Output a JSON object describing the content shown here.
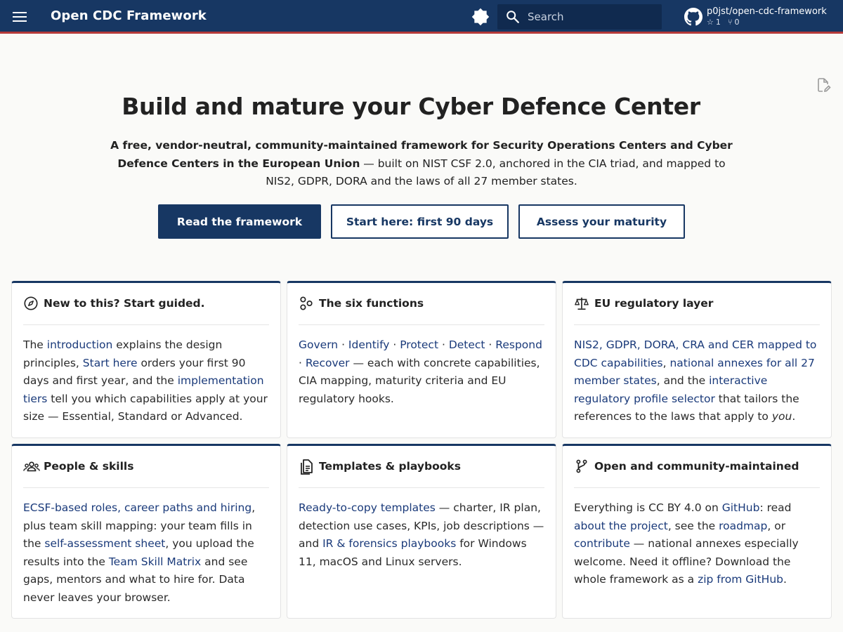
{
  "header": {
    "site_title": "Open CDC Framework",
    "search_placeholder": "Search",
    "repo_name": "p0jst/open-cdc-framework",
    "stars": "1",
    "forks": "0",
    "icons": {
      "menu": "menu-icon",
      "theme": "theme-toggle-icon",
      "search": "search-icon",
      "repo": "github-icon"
    }
  },
  "hero": {
    "title": "Build and mature your Cyber Defence Center",
    "subtitle_bold": "A free, vendor-neutral, community-maintained framework for Security Operations Centers and Cyber Defence Centers in the European Union",
    "subtitle_rest": " — built on NIST CSF 2.0, anchored in the CIA triad, and mapped to NIS2, GDPR, DORA and the laws of all 27 member states.",
    "buttons": {
      "read": "Read the framework",
      "start": "Start here: first 90 days",
      "assess": "Assess your maturity"
    }
  },
  "cards": {
    "guided": {
      "title": "New to this? Start guided.",
      "icon": "compass-icon",
      "t1": "The ",
      "l1": "introduction",
      "t2": " explains the design principles, ",
      "l2": "Start here",
      "t3": " orders your first 90 days and first year, and the ",
      "l3": "implementation tiers",
      "t4": " tell you which capabilities apply at your size — Essential, Standard or Advanced."
    },
    "functions": {
      "title": "The six functions",
      "icon": "functions-icon",
      "l1": "Govern",
      "sep": " · ",
      "l2": "Identify",
      "l3": "Protect",
      "l4": "Detect",
      "l5": "Respond",
      "l6": "Recover",
      "t1": " — each with concrete capabilities, CIA mapping, maturity criteria and EU regulatory hooks."
    },
    "regulatory": {
      "title": "EU regulatory layer",
      "icon": "scale-icon",
      "l1": "NIS2, GDPR, DORA, CRA and CER mapped to CDC capabilities",
      "t1": ", ",
      "l2": "national annexes for all 27 member states",
      "t2": ", and the ",
      "l3": "interactive regulatory profile selector",
      "t3": " that tailors the references to the laws that apply to ",
      "em": "you",
      "t4": "."
    },
    "people": {
      "title": "People & skills",
      "icon": "group-icon",
      "l1": "ECSF-based roles, career paths and hiring",
      "t1": ", plus team skill mapping: your team fills in the ",
      "l2": "self-assessment sheet",
      "t2": ", you upload the results into the ",
      "l3": "Team Skill Matrix",
      "t3": " and see gaps, mentors and what to hire for. Data never leaves your browser."
    },
    "templates": {
      "title": "Templates & playbooks",
      "icon": "document-icon",
      "l1": "Ready-to-copy templates",
      "t1": " — charter, IR plan, detection use cases, KPIs, job descriptions — and ",
      "l2": "IR & forensics playbooks",
      "t2": " for Windows 11, macOS and Linux servers."
    },
    "community": {
      "title": "Open and community-maintained",
      "icon": "source-branch-icon",
      "t1": "Everything is CC BY 4.0 on ",
      "l1": "GitHub",
      "t2": ": read ",
      "l2": "about the project",
      "t3": ", see the ",
      "l3": "roadmap",
      "t4": ", or ",
      "l4": "contribute",
      "t5": " — national annexes especially welcome. Need it offline? Download the whole framework as a ",
      "l5": "zip from GitHub",
      "t6": "."
    }
  },
  "colors": {
    "primary": "#173763",
    "accent": "#b53a3a",
    "link": "#1a3a7a",
    "background": "#fafaf8"
  }
}
